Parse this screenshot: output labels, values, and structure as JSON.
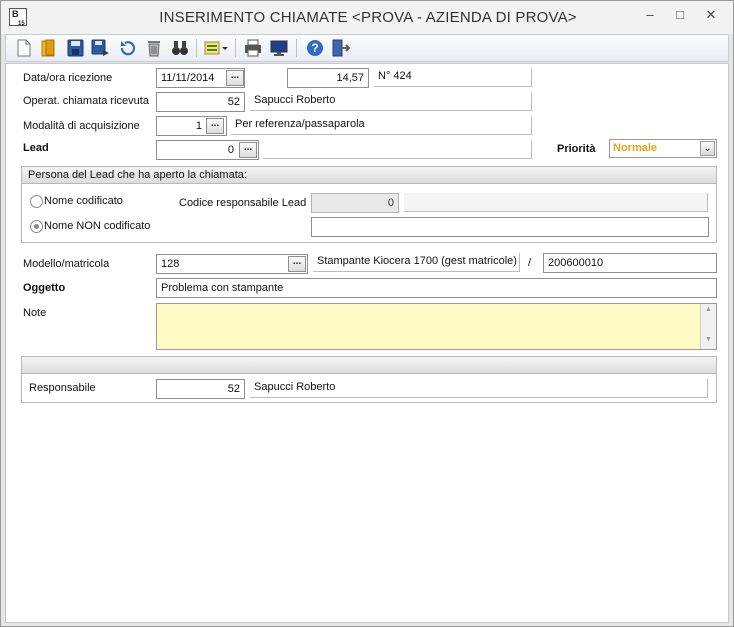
{
  "window": {
    "title": "INSERIMENTO CHIAMATE <PROVA - AZIENDA DI PROVA>",
    "icon_text": "B",
    "icon_sub": "15"
  },
  "toolbar": {
    "buttons": [
      "new-document-icon",
      "open-folder-icon",
      "save-icon",
      "save-as-icon",
      "undo-icon",
      "delete-icon",
      "search-binoculars-icon",
      "list-menu-icon",
      "print-icon",
      "preview-monitor-icon",
      "help-icon",
      "exit-door-icon"
    ]
  },
  "form": {
    "data_ora_label": "Data/ora ricezione",
    "data_value": "11/11/2014",
    "ora_value": "14,57",
    "numero_value": "N° 424",
    "operatore_label": "Operat. chiamata ricevuta",
    "operatore_code": "52",
    "operatore_name": "Sapucci Roberto",
    "modalita_label": "Modalità di acquisizione",
    "modalita_code": "1",
    "modalita_desc": "Per referenza/passaparola",
    "lead_label": "Lead",
    "lead_code": "0",
    "lead_desc": "",
    "priorita_label": "Priorità",
    "priorita_value": "Normale",
    "persona_group_title": "Persona del Lead che ha aperto la chiamata:",
    "radio_codificato": "Nome codificato",
    "radio_non_codificato": "Nome NON codificato",
    "codice_resp_label": "Codice responsabile Lead",
    "codice_resp_value": "0",
    "codice_resp_desc": "",
    "nome_non_codificato_value": "",
    "modello_label": "Modello/matricola",
    "modello_code": "128",
    "modello_desc": "Stampante Kiocera 1700  (gest matricole)",
    "matricola_sep": "/",
    "matricola_value": "200600010",
    "oggetto_label": "Oggetto",
    "oggetto_value": "Problema con stampante",
    "note_label": "Note",
    "note_value": "",
    "responsabile_group_title": "",
    "responsabile_label": "Responsabile",
    "responsabile_code": "52",
    "responsabile_name": "Sapucci Roberto"
  },
  "colors": {
    "priority_text": "#e9a21a",
    "note_background": "#fff9c4"
  }
}
